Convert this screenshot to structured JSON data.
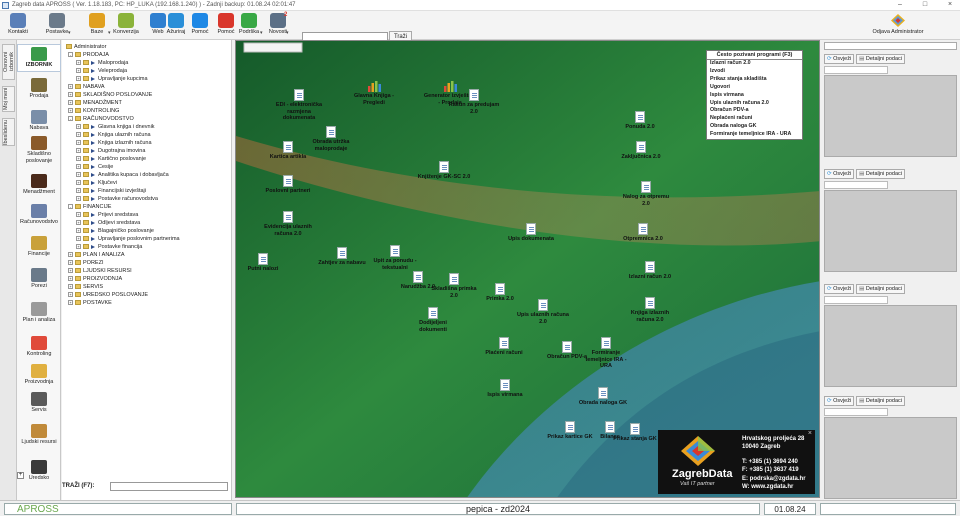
{
  "window": {
    "title": "Zagreb data APROSS  ( Ver. 1.18.183, PC: HP_LUKA (192.168.1.240) ) - Zadnji backup: 01.08.24 02:01:47"
  },
  "toolbar": {
    "items": [
      {
        "label": "Kontakti",
        "icon": "contacts-icon",
        "color": "#5a7fb8"
      },
      {
        "label": "Postavke",
        "icon": "tools-icon",
        "color": "#6b7a8a"
      },
      {
        "label": "Baze",
        "icon": "database-icon",
        "color": "#e0a020"
      },
      {
        "label": "Konverzija",
        "icon": "conversion-icon",
        "color": "#8bb33a"
      },
      {
        "label": "Web",
        "icon": "web-icon",
        "color": "#2e7fd0"
      },
      {
        "label": "Ažuriraj",
        "icon": "update-icon",
        "color": "#2a8fd8"
      },
      {
        "label": "Pomoć",
        "icon": "help-icon",
        "color": "#1e88e5"
      },
      {
        "label": "Pomoć",
        "icon": "anydesk-icon",
        "color": "#d9362b"
      },
      {
        "label": "Podrška",
        "icon": "support-icon",
        "color": "#39a845"
      },
      {
        "label": "Novosti",
        "icon": "news-icon",
        "color": "#5b6f86"
      }
    ],
    "news_badge": "2",
    "search_button": "Traži",
    "logout_label": "Odjava",
    "user_label": "Administrator"
  },
  "vtabs": [
    "Osnovni izbornik",
    "Moj meni",
    "Ibeslidenu"
  ],
  "modules": [
    {
      "label": "IZBORNIK",
      "icon": "menu-icon",
      "color": "#3a9a4a"
    },
    {
      "label": "Prodaja",
      "icon": "sales-icon",
      "color": "#7a6a3a"
    },
    {
      "label": "Nabava",
      "icon": "purchase-icon",
      "color": "#7a8ea8"
    },
    {
      "label": "Skladišno poslovanje",
      "icon": "warehouse-icon",
      "color": "#8a5a2a"
    },
    {
      "label": "Menadžment",
      "icon": "management-icon",
      "color": "#4a2a1a"
    },
    {
      "label": "Računovodstvo",
      "icon": "accounting-icon",
      "color": "#6a7fa8"
    },
    {
      "label": "Financije",
      "icon": "finance-icon",
      "color": "#c9a13a"
    },
    {
      "label": "Porezi",
      "icon": "tax-icon",
      "color": "#6a7a8a"
    },
    {
      "label": "Plan i analiza",
      "icon": "plan-icon",
      "color": "#9a9a9a"
    },
    {
      "label": "Kontroling",
      "icon": "controlling-icon",
      "color": "#e04a3a"
    },
    {
      "label": "Proizvodnja",
      "icon": "production-icon",
      "color": "#e0b040"
    },
    {
      "label": "Servis",
      "icon": "service-icon",
      "color": "#5a5a5a"
    },
    {
      "label": "Ljudski resursi",
      "icon": "hr-icon",
      "color": "#c08a3a"
    },
    {
      "label": "Uredsko",
      "icon": "office-icon",
      "color": "#3a3a3a"
    }
  ],
  "tree": [
    {
      "label": "Administrator",
      "level": 0,
      "type": "root"
    },
    {
      "label": "PRODAJA",
      "level": 1,
      "type": "folder",
      "exp": "-"
    },
    {
      "label": "Maloprodaja",
      "level": 2,
      "type": "item",
      "exp": "+"
    },
    {
      "label": "Veleprodaja",
      "level": 2,
      "type": "item",
      "exp": "+"
    },
    {
      "label": "Upravljanje kupcima",
      "level": 2,
      "type": "item",
      "exp": "+"
    },
    {
      "label": "NABAVA",
      "level": 1,
      "type": "folder",
      "exp": "+"
    },
    {
      "label": "SKLADIŠNO POSLOVANJE",
      "level": 1,
      "type": "folder",
      "exp": "+"
    },
    {
      "label": "MENADŽMENT",
      "level": 1,
      "type": "folder",
      "exp": "+"
    },
    {
      "label": "KONTROLING",
      "level": 1,
      "type": "folder",
      "exp": "+"
    },
    {
      "label": "RAČUNOVODSTVO",
      "level": 1,
      "type": "folder",
      "exp": "-"
    },
    {
      "label": "Glavna knjiga i dnevnik",
      "level": 2,
      "type": "item",
      "exp": "+"
    },
    {
      "label": "Knjiga ulaznih računa",
      "level": 2,
      "type": "item",
      "exp": "+"
    },
    {
      "label": "Knjiga izlaznih računa",
      "level": 2,
      "type": "item",
      "exp": "+"
    },
    {
      "label": "Dugotrajna imovina",
      "level": 2,
      "type": "item",
      "exp": "+"
    },
    {
      "label": "Kartično poslovanje",
      "level": 2,
      "type": "item",
      "exp": "+"
    },
    {
      "label": "Cesije",
      "level": 2,
      "type": "item",
      "exp": "+"
    },
    {
      "label": "Analitika kupaca i dobavljača",
      "level": 2,
      "type": "item",
      "exp": "+"
    },
    {
      "label": "Ključevi",
      "level": 2,
      "type": "item",
      "exp": "+"
    },
    {
      "label": "Financijski izvještaji",
      "level": 2,
      "type": "item",
      "exp": "+"
    },
    {
      "label": "Postavke računovodstva",
      "level": 2,
      "type": "item",
      "exp": "+"
    },
    {
      "label": "FINANCIJE",
      "level": 1,
      "type": "folder",
      "exp": "-"
    },
    {
      "label": "Prijevi sredstava",
      "level": 2,
      "type": "item",
      "exp": "+"
    },
    {
      "label": "Odljevi sredstava",
      "level": 2,
      "type": "item",
      "exp": "+"
    },
    {
      "label": "Blagajničko poslovanje",
      "level": 2,
      "type": "item",
      "exp": "+"
    },
    {
      "label": "Upravljanje poslovnim partnerima",
      "level": 2,
      "type": "item",
      "exp": "+"
    },
    {
      "label": "Postavke financija",
      "level": 2,
      "type": "item",
      "exp": "+"
    },
    {
      "label": "PLAN I ANALIZA",
      "level": 1,
      "type": "folder",
      "exp": "+"
    },
    {
      "label": "POREZI",
      "level": 1,
      "type": "folder",
      "exp": "+"
    },
    {
      "label": "LJUDSKI RESURSI",
      "level": 1,
      "type": "folder",
      "exp": "+"
    },
    {
      "label": "PROIZVODNJA",
      "level": 1,
      "type": "folder",
      "exp": "+"
    },
    {
      "label": "SERVIS",
      "level": 1,
      "type": "folder",
      "exp": "+"
    },
    {
      "label": "UREDSKO POSLOVANJE",
      "level": 1,
      "type": "folder",
      "exp": "+"
    },
    {
      "label": "POSTAVKE",
      "level": 1,
      "type": "folder",
      "exp": "+"
    }
  ],
  "tree_search_label": "TRAŽI (F7):",
  "desktop_icons": [
    {
      "label": "EDI - elektronička razmjena dokumenata",
      "kind": "doc"
    },
    {
      "label": "Glavna Knjiga - Pregledi",
      "kind": "chart"
    },
    {
      "label": "Generator izvještaja - Prodaja",
      "kind": "chart"
    },
    {
      "label": "Račun za predujam 2.0",
      "kind": "doc"
    },
    {
      "label": "Obrada utržka maloprodaje",
      "kind": "doc"
    },
    {
      "label": "Kartica artikla",
      "kind": "doc"
    },
    {
      "label": "Knjiženje GK-SC 2.0",
      "kind": "doc"
    },
    {
      "label": "Ponuda 2.0",
      "kind": "doc"
    },
    {
      "label": "Zaključnica 2.0",
      "kind": "doc"
    },
    {
      "label": "Poslovni partneri",
      "kind": "doc"
    },
    {
      "label": "Nalog za otpremu 2.0",
      "kind": "doc"
    },
    {
      "label": "Evidencija ulaznih računa 2.0",
      "kind": "doc"
    },
    {
      "label": "Upis dokumenata",
      "kind": "doc"
    },
    {
      "label": "Otpremnica 2.0",
      "kind": "doc"
    },
    {
      "label": "Upit za ponudu - tekstualni",
      "kind": "doc"
    },
    {
      "label": "Zahtjev za nabavu",
      "kind": "doc"
    },
    {
      "label": "Putni nalozi",
      "kind": "doc"
    },
    {
      "label": "Izlazni račun 2.0",
      "kind": "doc"
    },
    {
      "label": "Narudžba 2.0",
      "kind": "doc"
    },
    {
      "label": "Skladišna primka 2.0",
      "kind": "doc"
    },
    {
      "label": "Primka 2.0",
      "kind": "doc"
    },
    {
      "label": "Upis ulaznih računa 2.0",
      "kind": "doc"
    },
    {
      "label": "Knjiga izlaznih računa 2.0",
      "kind": "doc"
    },
    {
      "label": "Dodijeljeni dokumenti",
      "kind": "doc"
    },
    {
      "label": "Plaćeni računi",
      "kind": "doc"
    },
    {
      "label": "Obračun PDV-a",
      "kind": "doc"
    },
    {
      "label": "Formiranje temeljnice IRA - URA",
      "kind": "doc"
    },
    {
      "label": "Ispis virmana",
      "kind": "doc"
    },
    {
      "label": "Obrada naloga GK",
      "kind": "doc"
    },
    {
      "label": "Prikaz kartice GK",
      "kind": "doc"
    },
    {
      "label": "Bilance",
      "kind": "doc"
    },
    {
      "label": "Prikaz stanja GK",
      "kind": "doc"
    }
  ],
  "freq": {
    "title": "Često pozivani programi (F3)",
    "items": [
      "Izlazni račun 2.0",
      "Izvodi",
      "Prikaz stanja skladišta",
      "Ugovori",
      "Ispis virmana",
      "Upis ulaznih računa 2.0",
      "Obračun PDV-a",
      "Neplaćeni računi",
      "Obrada naloga GK",
      "Formiranje temeljnice IRA - URA"
    ]
  },
  "contact": {
    "brand": "ZagrebData",
    "tagline": "Vaš IT partner",
    "address1": "Hrvatskog proljeća 28",
    "address2": "10040 Zagreb",
    "tel": "T: +385 (1) 3694 240",
    "fax": "F: +385 (1) 3637 419",
    "email": "E: podrska@zgdata.hr",
    "web": "W: www.zgdata.hr",
    "close": "×"
  },
  "rpanels": [
    {
      "refresh": "Osvježi",
      "details": "Detaljni podaci"
    },
    {
      "refresh": "Osvježi",
      "details": "Detaljni podaci"
    },
    {
      "refresh": "Osvježi",
      "details": "Detaljni podaci"
    },
    {
      "refresh": "Osvježi",
      "details": "Detaljni podaci"
    }
  ],
  "status": {
    "app": "APROSS",
    "center": "pepica - zd2024",
    "date": "01.08.24"
  },
  "colors": {
    "desk_bg": "#1f6a33",
    "accent": "#6aa84f"
  }
}
